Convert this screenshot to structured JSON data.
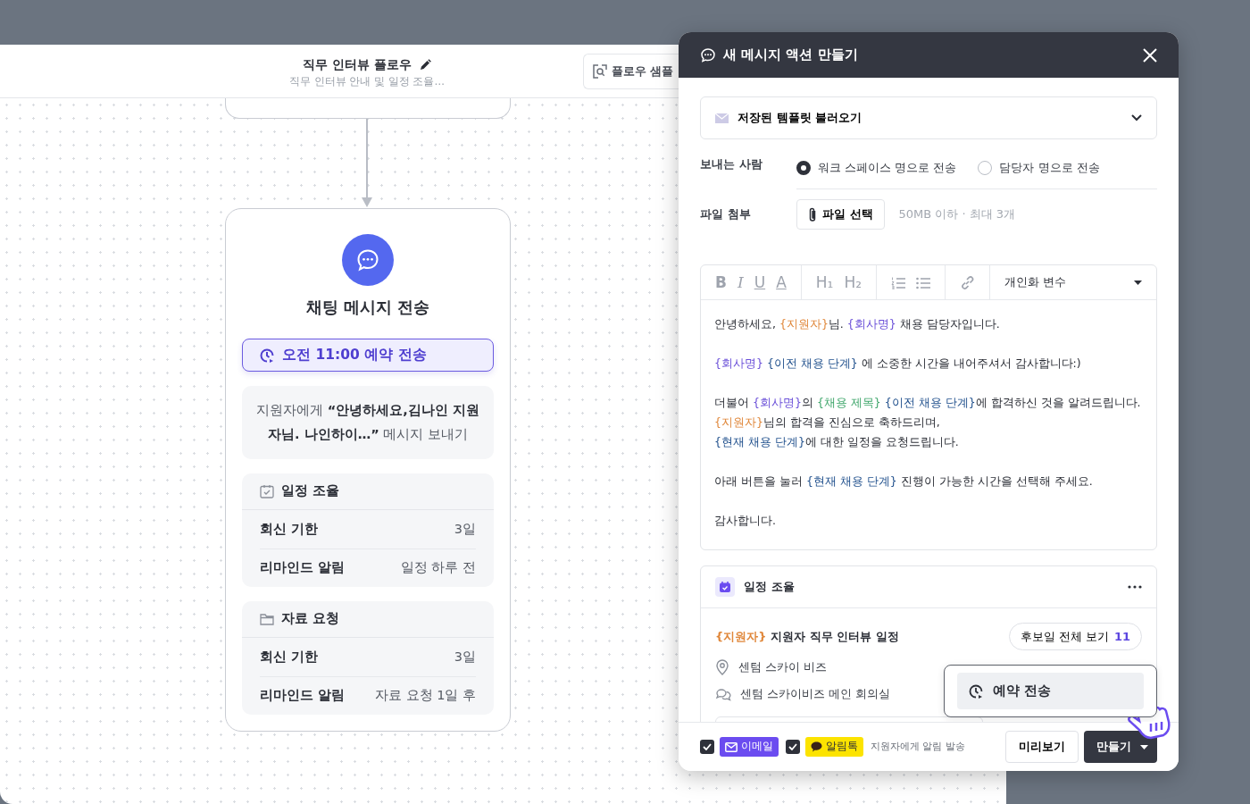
{
  "flow": {
    "title": "직무 인터뷰 플로우",
    "subtitle": "직무 인터뷰 안내 및 일정 조율…",
    "sample_button": "플로우 샘플"
  },
  "node": {
    "title": "채팅 메시지 전송",
    "schedule_badge": "오전 11:00 예약 전송",
    "message": "지원자에게 **“안녕하세요,김나인 지원자님. 나인하이…”** 메시지 보내기",
    "sections": [
      {
        "kind": "calendar",
        "title": "일정 조율",
        "rows": [
          {
            "label": "회신 기한",
            "value": "3일"
          },
          {
            "label": "리마인드 알림",
            "value": "일정 하루 전"
          }
        ]
      },
      {
        "kind": "folder",
        "title": "자료 요청",
        "rows": [
          {
            "label": "회신 기한",
            "value": "3일"
          },
          {
            "label": "리마인드 알림",
            "value": "자료 요청 1일 후"
          }
        ]
      }
    ]
  },
  "dialog": {
    "title": "새 메시지 액션 만들기",
    "template_select": "저장된 템플릿 불러오기",
    "sender": {
      "label": "보내는 사람",
      "options": [
        {
          "label": "워크 스페이스 명으로 전송",
          "selected": true
        },
        {
          "label": "담당자 명으로 전송",
          "selected": false
        }
      ]
    },
    "attachment": {
      "label": "파일 첨부",
      "button": "파일 선택",
      "hint": "50MB 이하 · 최대 3개"
    },
    "editor": {
      "toolbar": [
        [
          {
            "kind": "bold",
            "label": "B"
          },
          {
            "kind": "italic",
            "label": "I"
          },
          {
            "kind": "underline",
            "label": "U"
          },
          {
            "kind": "color",
            "label": "A"
          }
        ],
        [
          {
            "kind": "heading",
            "label": "H₁"
          },
          {
            "kind": "heading",
            "label": "H₂"
          }
        ],
        [
          {
            "kind": "ordered-list"
          },
          {
            "kind": "bullet-list"
          }
        ],
        [
          {
            "kind": "link"
          }
        ]
      ],
      "variable_select": "개인화 변수",
      "paragraphs": [
        [
          [
            {
              "text": "안녕하세요, "
            },
            {
              "text": "{지원자}",
              "color": "#e0873a"
            },
            {
              "text": "님. "
            },
            {
              "text": "{회사명}",
              "color": "#6a4fd8"
            },
            {
              "text": " 채용 담당자입니다."
            }
          ]
        ],
        [
          [
            {
              "text": "{회사명} ",
              "color": "#6a4fd8"
            },
            {
              "text": "{이전 채용 단계}",
              "color": "#1f4f8c"
            },
            {
              "text": " 에 소중한 시간을 내어주셔서 감사합니다:)"
            }
          ]
        ],
        [
          [
            {
              "text": "더불어 "
            },
            {
              "text": "{회사명}",
              "color": "#6a4fd8"
            },
            {
              "text": "의 "
            },
            {
              "text": "{채용 제목} ",
              "color": "#3fa66b"
            },
            {
              "text": "{이전 채용 단계}",
              "color": "#1f4f8c"
            },
            {
              "text": "에 합격하신 것을 알려드립니다."
            }
          ],
          [
            {
              "text": "{지원자}",
              "color": "#e0873a"
            },
            {
              "text": "님의 합격을 진심으로 축하드리며,"
            }
          ],
          [
            {
              "text": "{현재 채용 단계}",
              "color": "#1f4f8c"
            },
            {
              "text": "에 대한 일정을 요청드립니다."
            }
          ]
        ],
        [
          [
            {
              "text": "아래 버튼을 눌러 "
            },
            {
              "text": "{현재 채용 단계}",
              "color": "#1f4f8c"
            },
            {
              "text": " 진행이 가능한 시간을 선택해 주세요."
            }
          ]
        ],
        [
          [
            {
              "text": "감사합니다."
            }
          ]
        ]
      ]
    },
    "schedule_card": {
      "title": "일정 조율",
      "event_title": [
        {
          "text": "{지원자}",
          "color": "#e0873a"
        },
        {
          "text": " 지원자 직무 인터뷰 일정"
        }
      ],
      "view_all": "후보일 전체 보기",
      "count": "11",
      "location": "센텀 스카이 비즈",
      "room": "센텀 스카이비즈 메인 회의실"
    },
    "footer": {
      "channels": [
        {
          "kind": "email",
          "label": "이메일",
          "checked": true
        },
        {
          "kind": "alimtalk",
          "label": "알림톡",
          "checked": true
        }
      ],
      "note": "지원자에게 알림 발송",
      "preview_button": "미리보기",
      "create_button": "만들기"
    },
    "popover": {
      "item": "예약 전송"
    }
  }
}
